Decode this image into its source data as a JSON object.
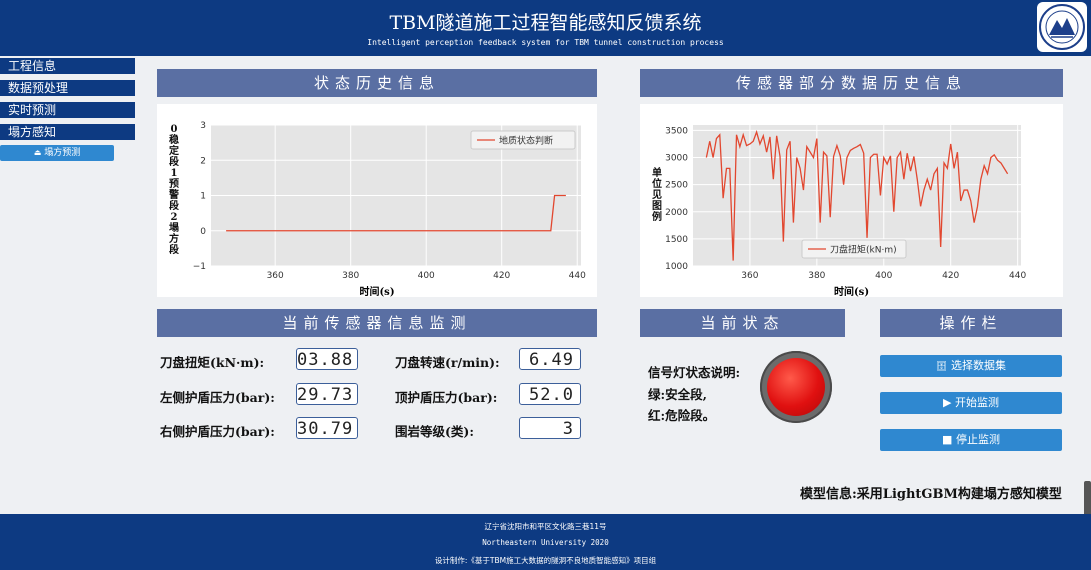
{
  "header": {
    "title": "TBM隧道施工过程智能感知反馈系统",
    "subtitle": "Intelligent perception feedback system for TBM tunnel construction process"
  },
  "sidebar": {
    "items": [
      {
        "label": "工程信息"
      },
      {
        "label": "数据预处理"
      },
      {
        "label": "实时预测"
      },
      {
        "label": "塌方感知"
      }
    ],
    "button_label": "塌方预测"
  },
  "panels": {
    "state_history_title": "状态历史信息",
    "sensor_history_title": "传感器部分数据历史信息",
    "current_sensor_title": "当前传感器信息监测",
    "current_state_title": "当前状态",
    "ops_title": "操作栏"
  },
  "chart_data": [
    {
      "type": "line",
      "series": [
        {
          "name": "地质状态判断",
          "x": [
            347,
            433,
            434,
            437
          ],
          "values": [
            0,
            0,
            1,
            1
          ]
        }
      ],
      "xlabel": "时间(s)",
      "ylabel": "0稳定段1预警段2塌方段",
      "xlim": [
        343,
        441
      ],
      "ylim": [
        -1,
        3
      ],
      "xticks": [
        360,
        380,
        400,
        420,
        440
      ],
      "yticks": [
        -1,
        0,
        1,
        2,
        3
      ],
      "grid": true,
      "legend": "top-right",
      "line_color": "#e2472f"
    },
    {
      "type": "line",
      "series": [
        {
          "name": "刀盘扭矩(kN·m)",
          "x": [
            347,
            348,
            349,
            350,
            351,
            352,
            353,
            354,
            355,
            356,
            357,
            358,
            359,
            360,
            361,
            362,
            363,
            364,
            365,
            366,
            367,
            368,
            369,
            370,
            371,
            372,
            373,
            374,
            375,
            376,
            377,
            378,
            379,
            380,
            381,
            382,
            383,
            384,
            385,
            386,
            387,
            388,
            389,
            390,
            391,
            392,
            393,
            394,
            395,
            396,
            397,
            398,
            399,
            400,
            401,
            402,
            403,
            404,
            405,
            406,
            407,
            408,
            409,
            410,
            411,
            412,
            413,
            414,
            415,
            416,
            417,
            418,
            419,
            420,
            421,
            422,
            423,
            424,
            425,
            426,
            427,
            428,
            429,
            430,
            431,
            432,
            433,
            434,
            435,
            436,
            437
          ],
          "values": [
            3000,
            3300,
            3000,
            3350,
            3420,
            2250,
            2800,
            2800,
            1100,
            3420,
            3200,
            3420,
            3220,
            3250,
            3300,
            3470,
            3250,
            3400,
            3100,
            3380,
            2600,
            3400,
            3020,
            1450,
            3140,
            3300,
            1800,
            3000,
            2800,
            2400,
            3200,
            3100,
            3000,
            3350,
            1800,
            3100,
            3030,
            1900,
            3020,
            3220,
            3030,
            2500,
            3000,
            3130,
            3170,
            3200,
            3240,
            3080,
            1520,
            3000,
            3060,
            3060,
            2300,
            3000,
            2880,
            3030,
            2000,
            3000,
            3100,
            2600,
            3080,
            2750,
            3020,
            2600,
            2100,
            2400,
            2600,
            2400,
            2700,
            2800,
            1350,
            2900,
            2800,
            3250,
            2800,
            3100,
            2200,
            2400,
            2400,
            2200,
            1800,
            2100,
            2600,
            2850,
            2700,
            3000,
            3050,
            2950,
            2900,
            2800,
            2700
          ],
          "color": "#e2472f"
        }
      ],
      "xlabel": "时间(s)",
      "ylabel": "单位见图例",
      "xlim": [
        343,
        441
      ],
      "ylim": [
        1000,
        3600
      ],
      "xticks": [
        360,
        380,
        400,
        420,
        440
      ],
      "yticks": [
        1000,
        1500,
        2000,
        2500,
        3000,
        3500
      ],
      "grid": true,
      "legend": "bottom-center"
    }
  ],
  "sensors": {
    "torque_label": "刀盘扭矩(kN·m):",
    "torque_value": "03.88",
    "speed_label": "刀盘转速(r/min):",
    "speed_value": "6.49",
    "left_label": "左侧护盾压力(bar):",
    "left_value": "29.73",
    "top_label": "顶护盾压力(bar):",
    "top_value": "52.0",
    "right_label": "右侧护盾压力(bar):",
    "right_value": "30.79",
    "rock_label": "围岩等级(类):",
    "rock_value": "3"
  },
  "state": {
    "desc_title": "信号灯状态说明:",
    "desc_green": "绿:安全段,",
    "desc_red": "红:危险段。",
    "light_color": "#e01010"
  },
  "ops": {
    "select_dataset": "选择数据集",
    "start": "开始监测",
    "stop": "停止监测"
  },
  "model_info": "模型信息:采用LightGBM构建塌方感知模型",
  "footer": {
    "address": "辽宁省沈阳市和平区文化路三巷11号",
    "university": "Northeastern University 2020",
    "credit": "设计制作:《基于TBM施工大数据的隧洞不良地质智能感知》项目组"
  }
}
